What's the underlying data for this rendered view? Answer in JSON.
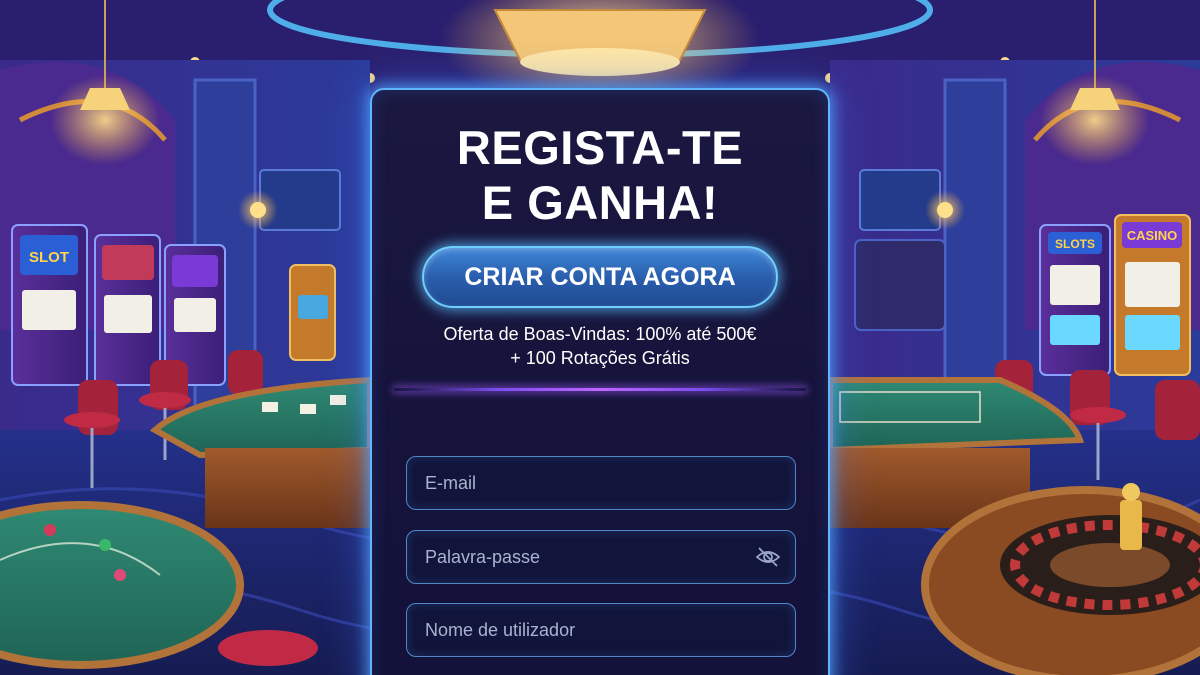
{
  "registration": {
    "title_line1": "REGISTA-TE",
    "title_line2": "E GANHA!",
    "cta_label": "CRIAR CONTA AGORA",
    "offer_line1": "Oferta de Boas-Vindas: 100% até 500€",
    "offer_line2": "+ 100 Rotações Grátis",
    "fields": {
      "email_placeholder": "E-mail",
      "password_placeholder": "Palavra-passe",
      "username_placeholder": "Nome de utilizador"
    },
    "password_toggle_icon": "eye-slash-icon"
  },
  "background": {
    "left_slot_sign": "SLOT",
    "right_slot_sign_1": "SLOTS",
    "right_slot_sign_2": "CASINO"
  },
  "colors": {
    "panel_border": "#5fb6ff",
    "cta_fill": "#2a5fae",
    "divider": "#c066ff"
  }
}
